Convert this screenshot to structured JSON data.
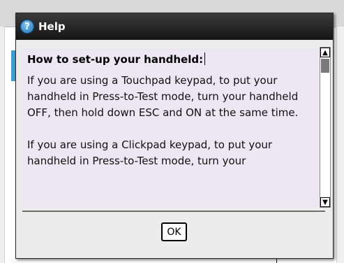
{
  "dialog": {
    "title": "Help",
    "heading": "How to set-up your handheld:",
    "paragraphs": [
      "If you are using a Touchpad keypad, to put your handheld in Press-to-Test mode, turn your handheld OFF, then hold down ESC and ON at the same time.",
      "If you are using a Clickpad keypad, to put your handheld in Press-to-Test mode, turn your"
    ],
    "ok_label": "OK"
  },
  "icons": {
    "help": "help-circle-icon",
    "scroll_up": "arrow-up-icon",
    "scroll_down": "arrow-down-icon"
  },
  "colors": {
    "titlebar": "#1f1f1f",
    "content_bg": "#ece7f2",
    "accent": "#3aa0d6"
  }
}
